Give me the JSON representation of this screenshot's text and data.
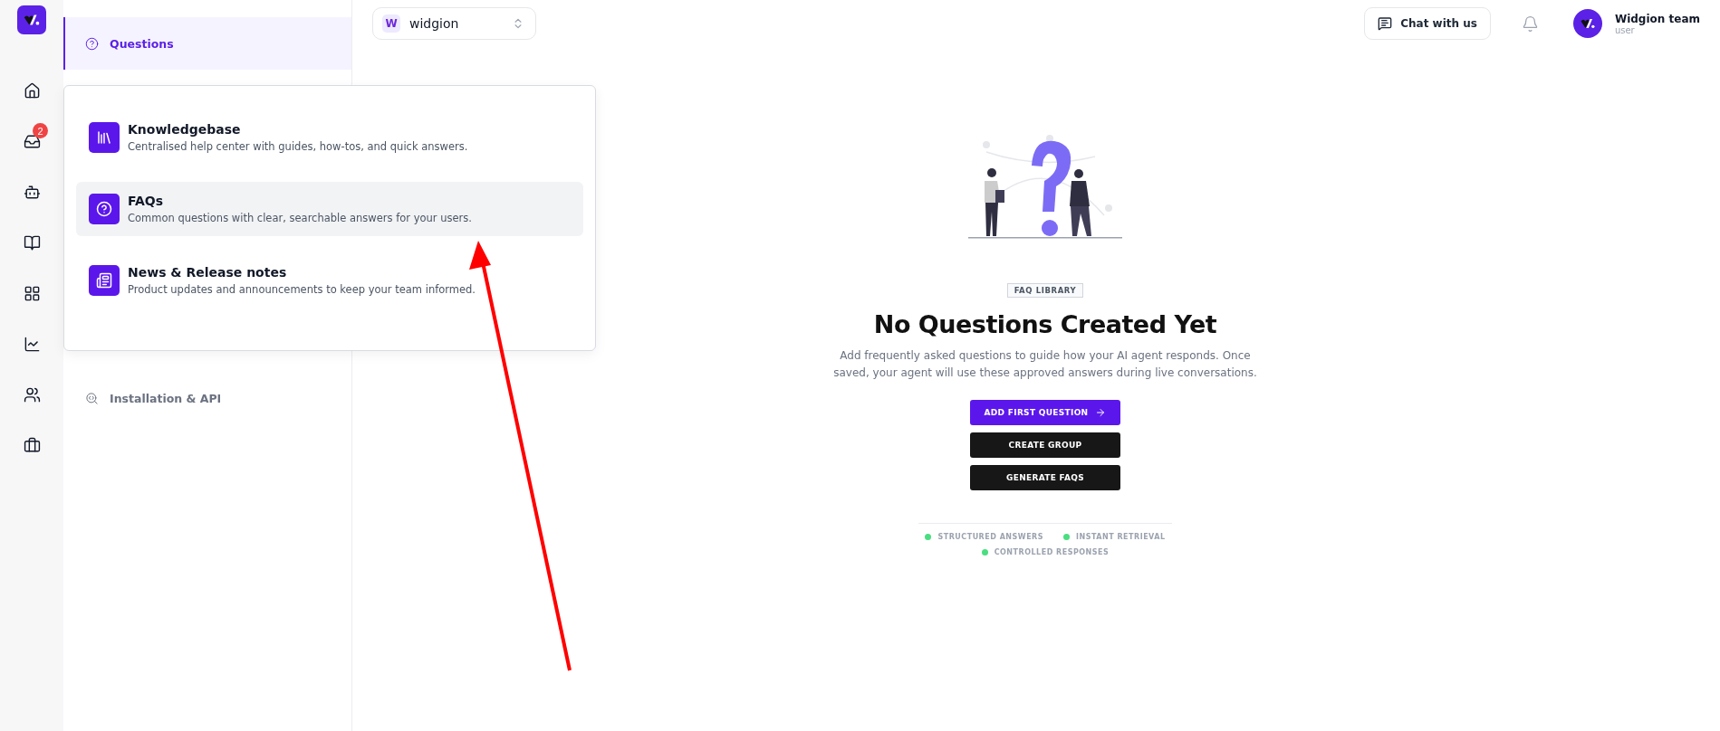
{
  "rail": {
    "items": [
      {
        "kind": "home"
      },
      {
        "kind": "inbox",
        "badge": "2"
      },
      {
        "kind": "bot"
      },
      {
        "kind": "book"
      },
      {
        "kind": "apps"
      },
      {
        "kind": "chart"
      },
      {
        "kind": "users"
      },
      {
        "kind": "briefcase"
      }
    ]
  },
  "sidebar": {
    "items": [
      {
        "kind": "question",
        "label": "Questions",
        "selected": true
      },
      {
        "kind": "search",
        "label": "Installation & API",
        "selected": false
      }
    ]
  },
  "menu": {
    "items": [
      {
        "kind": "library",
        "title": "Knowledgebase",
        "description": "Centralised help center with guides, how-tos, and quick answers.",
        "selected": false
      },
      {
        "kind": "faq",
        "title": "FAQs",
        "description": "Common questions with clear, searchable answers for your users.",
        "selected": true
      },
      {
        "kind": "news",
        "title": "News & Release notes",
        "description": "Product updates and announcements to keep your team informed.",
        "selected": false
      }
    ]
  },
  "workspace": {
    "initial": "W",
    "name": "widgion"
  },
  "header": {
    "chat_button": "Chat with us",
    "user_name": "Widgion team",
    "user_role": "user"
  },
  "empty_state": {
    "badge": "FAQ LIBRARY",
    "title": "No Questions Created Yet",
    "description": "Add frequently asked questions to guide how your AI agent responds. Once saved, your agent will use these approved answers during live conversations.",
    "buttons": [
      {
        "kind": "primary",
        "label": "ADD FIRST QUESTION"
      },
      {
        "kind": "dark",
        "label": "CREATE GROUP"
      },
      {
        "kind": "dark",
        "label": "GENERATE FAQS"
      }
    ],
    "features": [
      {
        "label": "STRUCTURED ANSWERS",
        "color": "#4ade80"
      },
      {
        "label": "INSTANT RETRIEVAL",
        "color": "#4ade80"
      },
      {
        "label": "CONTROLLED RESPONSES",
        "color": "#4ade80"
      }
    ]
  }
}
